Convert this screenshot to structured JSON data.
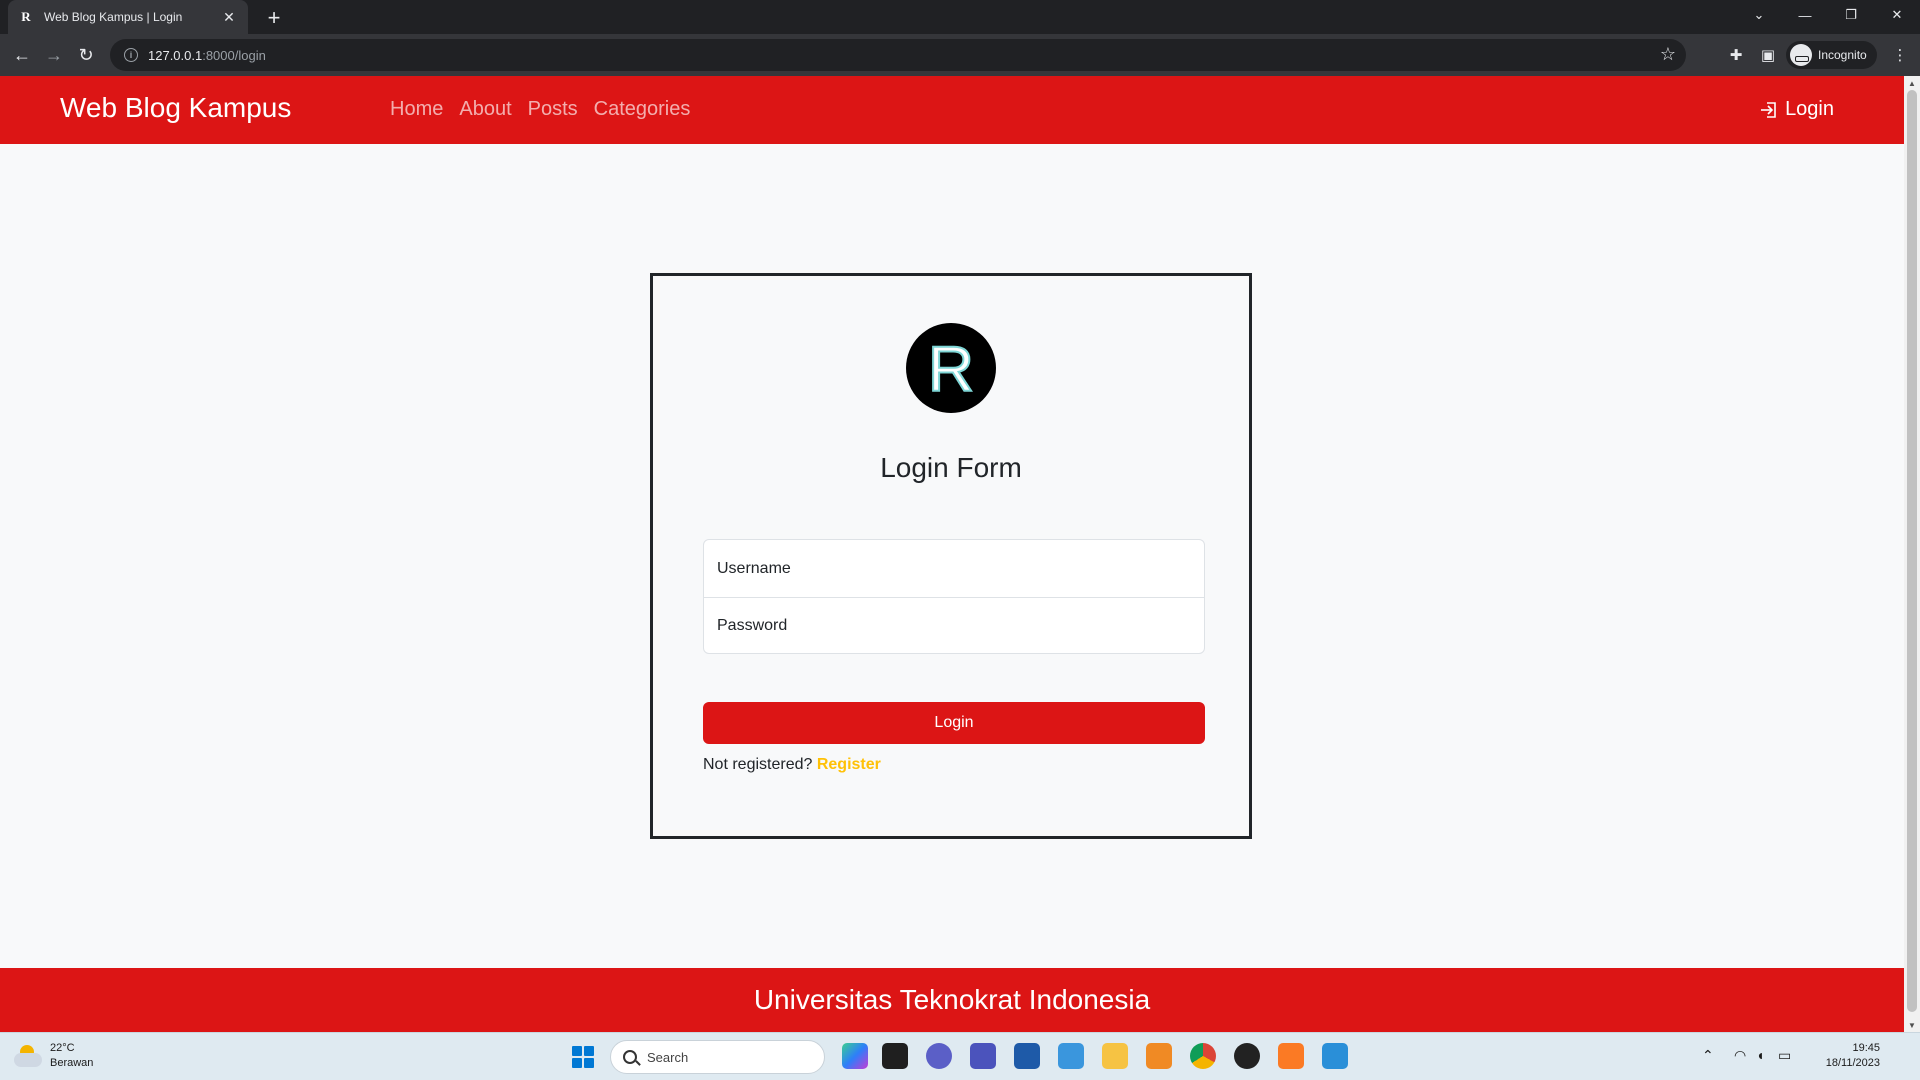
{
  "browser": {
    "tab_title": "Web Blog Kampus | Login",
    "tab_favicon_letter": "R",
    "url_host": "127.0.0.1",
    "url_path": ":8000/login",
    "profile_label": "Incognito"
  },
  "navbar": {
    "brand": "Web Blog Kampus",
    "links": [
      {
        "label": "Home"
      },
      {
        "label": "About"
      },
      {
        "label": "Posts"
      },
      {
        "label": "Categories"
      }
    ],
    "login_label": "Login",
    "background_color": "#dc1515"
  },
  "login_form": {
    "logo_letter": "R",
    "title": "Login Form",
    "username_placeholder": "Username",
    "password_placeholder": "Password",
    "submit_label": "Login",
    "register_prompt": "Not registered?",
    "register_link": "Register",
    "accent_color": "#dc1515",
    "link_color": "#ffc107"
  },
  "footer": {
    "text": "Universitas Teknokrat Indonesia"
  },
  "taskbar": {
    "weather_temp": "22°C",
    "weather_desc": "Berawan",
    "search_placeholder": "Search",
    "time": "19:45",
    "date": "18/11/2023"
  }
}
